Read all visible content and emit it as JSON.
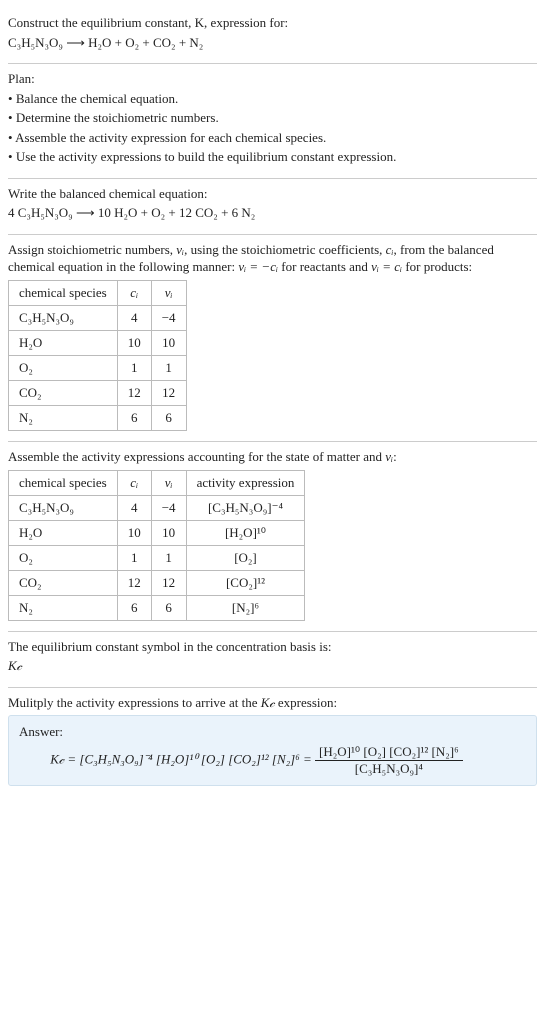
{
  "intro": {
    "line1": "Construct the equilibrium constant, K, expression for:",
    "equation": "C₃H₅N₃O₉ ⟶ H₂O + O₂ + CO₂ + N₂"
  },
  "plan": {
    "title": "Plan:",
    "items": [
      "Balance the chemical equation.",
      "Determine the stoichiometric numbers.",
      "Assemble the activity expression for each chemical species.",
      "Use the activity expressions to build the equilibrium constant expression."
    ]
  },
  "balanced": {
    "title": "Write the balanced chemical equation:",
    "equation": "4 C₃H₅N₃O₉ ⟶ 10 H₂O + O₂ + 12 CO₂ + 6 N₂"
  },
  "assign": {
    "text_a": "Assign stoichiometric numbers, ",
    "nu_i": "νᵢ",
    "text_b": ", using the stoichiometric coefficients, ",
    "c_i": "cᵢ",
    "text_c": ", from the balanced chemical equation in the following manner: ",
    "rel1": "νᵢ = −cᵢ",
    "text_d": " for reactants and ",
    "rel2": "νᵢ = cᵢ",
    "text_e": " for products:"
  },
  "table1": {
    "headers": [
      "chemical species",
      "cᵢ",
      "νᵢ"
    ],
    "rows": [
      [
        "C₃H₅N₃O₉",
        "4",
        "−4"
      ],
      [
        "H₂O",
        "10",
        "10"
      ],
      [
        "O₂",
        "1",
        "1"
      ],
      [
        "CO₂",
        "12",
        "12"
      ],
      [
        "N₂",
        "6",
        "6"
      ]
    ]
  },
  "assemble": {
    "text_a": "Assemble the activity expressions accounting for the state of matter and ",
    "nu_i": "νᵢ",
    "text_b": ":"
  },
  "table2": {
    "headers": [
      "chemical species",
      "cᵢ",
      "νᵢ",
      "activity expression"
    ],
    "rows": [
      [
        "C₃H₅N₃O₉",
        "4",
        "−4",
        "[C₃H₅N₃O₉]⁻⁴"
      ],
      [
        "H₂O",
        "10",
        "10",
        "[H₂O]¹⁰"
      ],
      [
        "O₂",
        "1",
        "1",
        "[O₂]"
      ],
      [
        "CO₂",
        "12",
        "12",
        "[CO₂]¹²"
      ],
      [
        "N₂",
        "6",
        "6",
        "[N₂]⁶"
      ]
    ]
  },
  "symbol": {
    "line1": "The equilibrium constant symbol in the concentration basis is:",
    "line2": "K𝒸"
  },
  "multiply": {
    "text_a": "Mulitply the activity expressions to arrive at the ",
    "kc": "K𝒸",
    "text_b": " expression:"
  },
  "answer": {
    "label": "Answer:",
    "lhs": "K𝒸 = [C₃H₅N₃O₉]⁻⁴ [H₂O]¹⁰ [O₂] [CO₂]¹² [N₂]⁶ = ",
    "numerator": "[H₂O]¹⁰ [O₂] [CO₂]¹² [N₂]⁶",
    "denominator": "[C₃H₅N₃O₉]⁴"
  },
  "chart_data": {
    "type": "table",
    "tables": [
      {
        "title": "Stoichiometric numbers",
        "columns": [
          "chemical species",
          "c_i",
          "nu_i"
        ],
        "rows": [
          {
            "chemical species": "C3H5N3O9",
            "c_i": 4,
            "nu_i": -4
          },
          {
            "chemical species": "H2O",
            "c_i": 10,
            "nu_i": 10
          },
          {
            "chemical species": "O2",
            "c_i": 1,
            "nu_i": 1
          },
          {
            "chemical species": "CO2",
            "c_i": 12,
            "nu_i": 12
          },
          {
            "chemical species": "N2",
            "c_i": 6,
            "nu_i": 6
          }
        ]
      },
      {
        "title": "Activity expressions",
        "columns": [
          "chemical species",
          "c_i",
          "nu_i",
          "activity expression"
        ],
        "rows": [
          {
            "chemical species": "C3H5N3O9",
            "c_i": 4,
            "nu_i": -4,
            "activity expression": "[C3H5N3O9]^-4"
          },
          {
            "chemical species": "H2O",
            "c_i": 10,
            "nu_i": 10,
            "activity expression": "[H2O]^10"
          },
          {
            "chemical species": "O2",
            "c_i": 1,
            "nu_i": 1,
            "activity expression": "[O2]"
          },
          {
            "chemical species": "CO2",
            "c_i": 12,
            "nu_i": 12,
            "activity expression": "[CO2]^12"
          },
          {
            "chemical species": "N2",
            "c_i": 6,
            "nu_i": 6,
            "activity expression": "[N2]^6"
          }
        ]
      }
    ]
  }
}
